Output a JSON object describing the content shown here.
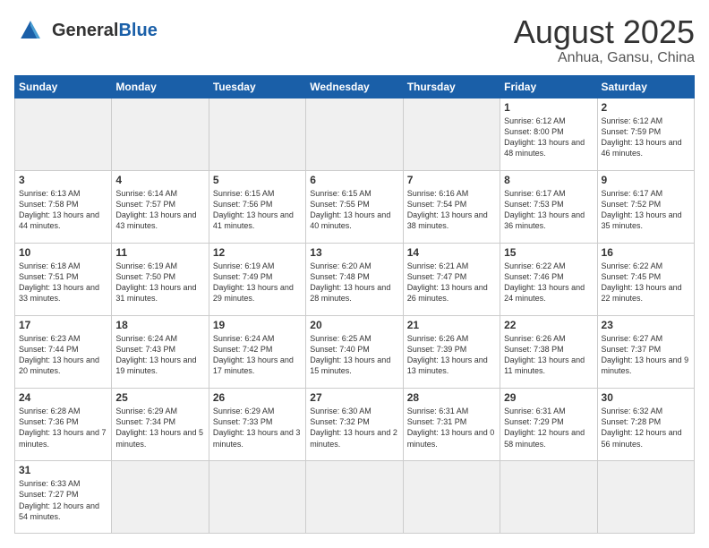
{
  "logo": {
    "text_general": "General",
    "text_blue": "Blue"
  },
  "title": "August 2025",
  "location": "Anhua, Gansu, China",
  "weekdays": [
    "Sunday",
    "Monday",
    "Tuesday",
    "Wednesday",
    "Thursday",
    "Friday",
    "Saturday"
  ],
  "weeks": [
    [
      {
        "day": "",
        "info": "",
        "empty": true
      },
      {
        "day": "",
        "info": "",
        "empty": true
      },
      {
        "day": "",
        "info": "",
        "empty": true
      },
      {
        "day": "",
        "info": "",
        "empty": true
      },
      {
        "day": "",
        "info": "",
        "empty": true
      },
      {
        "day": "1",
        "info": "Sunrise: 6:12 AM\nSunset: 8:00 PM\nDaylight: 13 hours and 48 minutes."
      },
      {
        "day": "2",
        "info": "Sunrise: 6:12 AM\nSunset: 7:59 PM\nDaylight: 13 hours and 46 minutes."
      }
    ],
    [
      {
        "day": "3",
        "info": "Sunrise: 6:13 AM\nSunset: 7:58 PM\nDaylight: 13 hours and 44 minutes."
      },
      {
        "day": "4",
        "info": "Sunrise: 6:14 AM\nSunset: 7:57 PM\nDaylight: 13 hours and 43 minutes."
      },
      {
        "day": "5",
        "info": "Sunrise: 6:15 AM\nSunset: 7:56 PM\nDaylight: 13 hours and 41 minutes."
      },
      {
        "day": "6",
        "info": "Sunrise: 6:15 AM\nSunset: 7:55 PM\nDaylight: 13 hours and 40 minutes."
      },
      {
        "day": "7",
        "info": "Sunrise: 6:16 AM\nSunset: 7:54 PM\nDaylight: 13 hours and 38 minutes."
      },
      {
        "day": "8",
        "info": "Sunrise: 6:17 AM\nSunset: 7:53 PM\nDaylight: 13 hours and 36 minutes."
      },
      {
        "day": "9",
        "info": "Sunrise: 6:17 AM\nSunset: 7:52 PM\nDaylight: 13 hours and 35 minutes."
      }
    ],
    [
      {
        "day": "10",
        "info": "Sunrise: 6:18 AM\nSunset: 7:51 PM\nDaylight: 13 hours and 33 minutes."
      },
      {
        "day": "11",
        "info": "Sunrise: 6:19 AM\nSunset: 7:50 PM\nDaylight: 13 hours and 31 minutes."
      },
      {
        "day": "12",
        "info": "Sunrise: 6:19 AM\nSunset: 7:49 PM\nDaylight: 13 hours and 29 minutes."
      },
      {
        "day": "13",
        "info": "Sunrise: 6:20 AM\nSunset: 7:48 PM\nDaylight: 13 hours and 28 minutes."
      },
      {
        "day": "14",
        "info": "Sunrise: 6:21 AM\nSunset: 7:47 PM\nDaylight: 13 hours and 26 minutes."
      },
      {
        "day": "15",
        "info": "Sunrise: 6:22 AM\nSunset: 7:46 PM\nDaylight: 13 hours and 24 minutes."
      },
      {
        "day": "16",
        "info": "Sunrise: 6:22 AM\nSunset: 7:45 PM\nDaylight: 13 hours and 22 minutes."
      }
    ],
    [
      {
        "day": "17",
        "info": "Sunrise: 6:23 AM\nSunset: 7:44 PM\nDaylight: 13 hours and 20 minutes."
      },
      {
        "day": "18",
        "info": "Sunrise: 6:24 AM\nSunset: 7:43 PM\nDaylight: 13 hours and 19 minutes."
      },
      {
        "day": "19",
        "info": "Sunrise: 6:24 AM\nSunset: 7:42 PM\nDaylight: 13 hours and 17 minutes."
      },
      {
        "day": "20",
        "info": "Sunrise: 6:25 AM\nSunset: 7:40 PM\nDaylight: 13 hours and 15 minutes."
      },
      {
        "day": "21",
        "info": "Sunrise: 6:26 AM\nSunset: 7:39 PM\nDaylight: 13 hours and 13 minutes."
      },
      {
        "day": "22",
        "info": "Sunrise: 6:26 AM\nSunset: 7:38 PM\nDaylight: 13 hours and 11 minutes."
      },
      {
        "day": "23",
        "info": "Sunrise: 6:27 AM\nSunset: 7:37 PM\nDaylight: 13 hours and 9 minutes."
      }
    ],
    [
      {
        "day": "24",
        "info": "Sunrise: 6:28 AM\nSunset: 7:36 PM\nDaylight: 13 hours and 7 minutes."
      },
      {
        "day": "25",
        "info": "Sunrise: 6:29 AM\nSunset: 7:34 PM\nDaylight: 13 hours and 5 minutes."
      },
      {
        "day": "26",
        "info": "Sunrise: 6:29 AM\nSunset: 7:33 PM\nDaylight: 13 hours and 3 minutes."
      },
      {
        "day": "27",
        "info": "Sunrise: 6:30 AM\nSunset: 7:32 PM\nDaylight: 13 hours and 2 minutes."
      },
      {
        "day": "28",
        "info": "Sunrise: 6:31 AM\nSunset: 7:31 PM\nDaylight: 13 hours and 0 minutes."
      },
      {
        "day": "29",
        "info": "Sunrise: 6:31 AM\nSunset: 7:29 PM\nDaylight: 12 hours and 58 minutes."
      },
      {
        "day": "30",
        "info": "Sunrise: 6:32 AM\nSunset: 7:28 PM\nDaylight: 12 hours and 56 minutes."
      }
    ],
    [
      {
        "day": "31",
        "info": "Sunrise: 6:33 AM\nSunset: 7:27 PM\nDaylight: 12 hours and 54 minutes.",
        "last": true
      },
      {
        "day": "",
        "info": "",
        "empty": true,
        "last": true
      },
      {
        "day": "",
        "info": "",
        "empty": true,
        "last": true
      },
      {
        "day": "",
        "info": "",
        "empty": true,
        "last": true
      },
      {
        "day": "",
        "info": "",
        "empty": true,
        "last": true
      },
      {
        "day": "",
        "info": "",
        "empty": true,
        "last": true
      },
      {
        "day": "",
        "info": "",
        "empty": true,
        "last": true
      }
    ]
  ]
}
